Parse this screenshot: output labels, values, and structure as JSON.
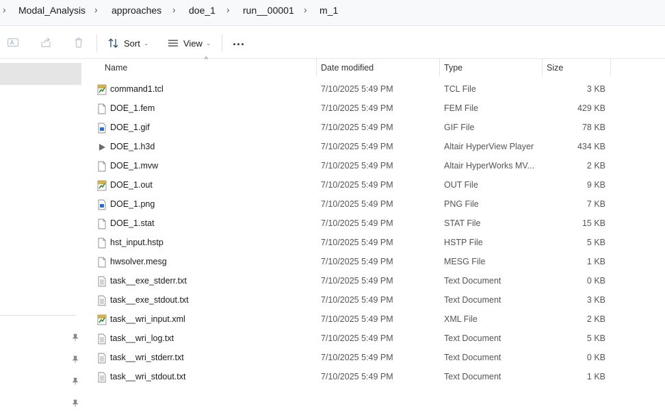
{
  "breadcrumb": [
    "Modal_Analysis",
    "approaches",
    "doe_1",
    "run__00001",
    "m_1"
  ],
  "toolbar": {
    "sort_label": "Sort",
    "view_label": "View",
    "more_label": "..."
  },
  "columns": {
    "name": "Name",
    "date": "Date modified",
    "type": "Type",
    "size": "Size"
  },
  "files": [
    {
      "name": "command1.tcl",
      "date": "7/10/2025 5:49 PM",
      "type": "TCL File",
      "size": "3 KB",
      "icon": "script-file-icon"
    },
    {
      "name": "DOE_1.fem",
      "date": "7/10/2025 5:49 PM",
      "type": "FEM File",
      "size": "429 KB",
      "icon": "blank-file-icon"
    },
    {
      "name": "DOE_1.gif",
      "date": "7/10/2025 5:49 PM",
      "type": "GIF File",
      "size": "78 KB",
      "icon": "image-file-icon"
    },
    {
      "name": "DOE_1.h3d",
      "date": "7/10/2025 5:49 PM",
      "type": "Altair HyperView Player",
      "size": "434 KB",
      "icon": "play-icon"
    },
    {
      "name": "DOE_1.mvw",
      "date": "7/10/2025 5:49 PM",
      "type": "Altair HyperWorks MV...",
      "size": "2 KB",
      "icon": "blank-file-icon"
    },
    {
      "name": "DOE_1.out",
      "date": "7/10/2025 5:49 PM",
      "type": "OUT File",
      "size": "9 KB",
      "icon": "script-file-icon"
    },
    {
      "name": "DOE_1.png",
      "date": "7/10/2025 5:49 PM",
      "type": "PNG File",
      "size": "7 KB",
      "icon": "image-file-icon"
    },
    {
      "name": "DOE_1.stat",
      "date": "7/10/2025 5:49 PM",
      "type": "STAT File",
      "size": "15 KB",
      "icon": "blank-file-icon"
    },
    {
      "name": "hst_input.hstp",
      "date": "7/10/2025 5:49 PM",
      "type": "HSTP File",
      "size": "5 KB",
      "icon": "blank-file-icon"
    },
    {
      "name": "hwsolver.mesg",
      "date": "7/10/2025 5:49 PM",
      "type": "MESG File",
      "size": "1 KB",
      "icon": "blank-file-icon"
    },
    {
      "name": "task__exe_stderr.txt",
      "date": "7/10/2025 5:49 PM",
      "type": "Text Document",
      "size": "0 KB",
      "icon": "text-file-icon"
    },
    {
      "name": "task__exe_stdout.txt",
      "date": "7/10/2025 5:49 PM",
      "type": "Text Document",
      "size": "3 KB",
      "icon": "text-file-icon"
    },
    {
      "name": "task__wri_input.xml",
      "date": "7/10/2025 5:49 PM",
      "type": "XML File",
      "size": "2 KB",
      "icon": "script-file-icon"
    },
    {
      "name": "task__wri_log.txt",
      "date": "7/10/2025 5:49 PM",
      "type": "Text Document",
      "size": "5 KB",
      "icon": "text-file-icon"
    },
    {
      "name": "task__wri_stderr.txt",
      "date": "7/10/2025 5:49 PM",
      "type": "Text Document",
      "size": "0 KB",
      "icon": "text-file-icon"
    },
    {
      "name": "task__wri_stdout.txt",
      "date": "7/10/2025 5:49 PM",
      "type": "Text Document",
      "size": "1 KB",
      "icon": "text-file-icon"
    }
  ],
  "colors": {
    "selection": "#e5e5e5",
    "accent": "#0067c0",
    "script_green": "#2e8b2e"
  }
}
